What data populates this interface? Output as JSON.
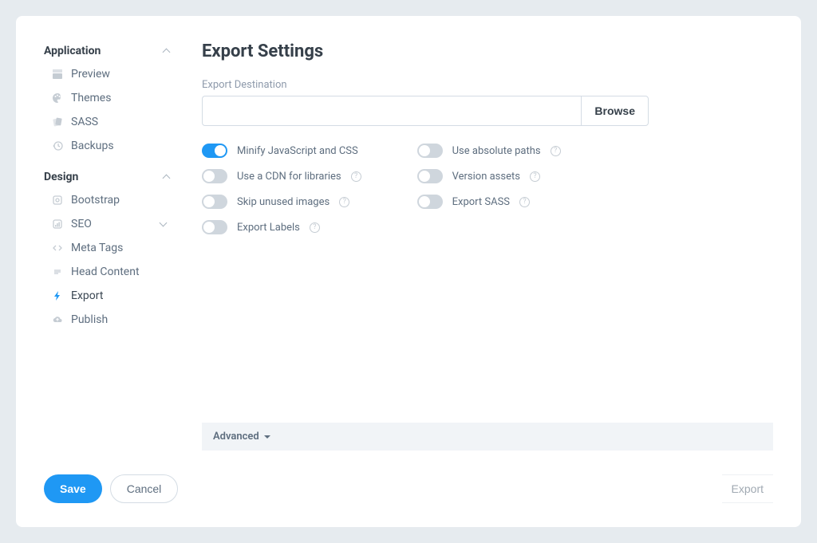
{
  "sidebar": {
    "sections": [
      {
        "title": "Application",
        "items": [
          {
            "icon": "clapper",
            "label": "Preview"
          },
          {
            "icon": "palette",
            "label": "Themes"
          },
          {
            "icon": "cards",
            "label": "SASS"
          },
          {
            "icon": "history",
            "label": "Backups"
          }
        ]
      },
      {
        "title": "Design",
        "items": [
          {
            "icon": "bootstrap",
            "label": "Bootstrap"
          },
          {
            "icon": "chart",
            "label": "SEO",
            "has_children": true
          },
          {
            "icon": "code",
            "label": "Meta Tags",
            "sub": true
          },
          {
            "icon": "lines",
            "label": "Head Content",
            "sub": true
          },
          {
            "icon": "bolt",
            "label": "Export",
            "sub": true,
            "active": true
          },
          {
            "icon": "cloud",
            "label": "Publish"
          }
        ]
      }
    ]
  },
  "main": {
    "title": "Export Settings",
    "destination_label": "Export Destination",
    "destination_value": "",
    "browse_label": "Browse",
    "options_left": [
      {
        "label": "Minify JavaScript and CSS",
        "on": true,
        "help": false
      },
      {
        "label": "Use a CDN for libraries",
        "on": false,
        "help": true
      },
      {
        "label": "Skip unused images",
        "on": false,
        "help": true
      },
      {
        "label": "Export Labels",
        "on": false,
        "help": true
      }
    ],
    "options_right": [
      {
        "label": "Use absolute paths",
        "on": false,
        "help": true
      },
      {
        "label": "Version assets",
        "on": false,
        "help": true
      },
      {
        "label": "Export SASS",
        "on": false,
        "help": true
      }
    ],
    "advanced_label": "Advanced"
  },
  "footer": {
    "save": "Save",
    "cancel": "Cancel",
    "export": "Export"
  }
}
